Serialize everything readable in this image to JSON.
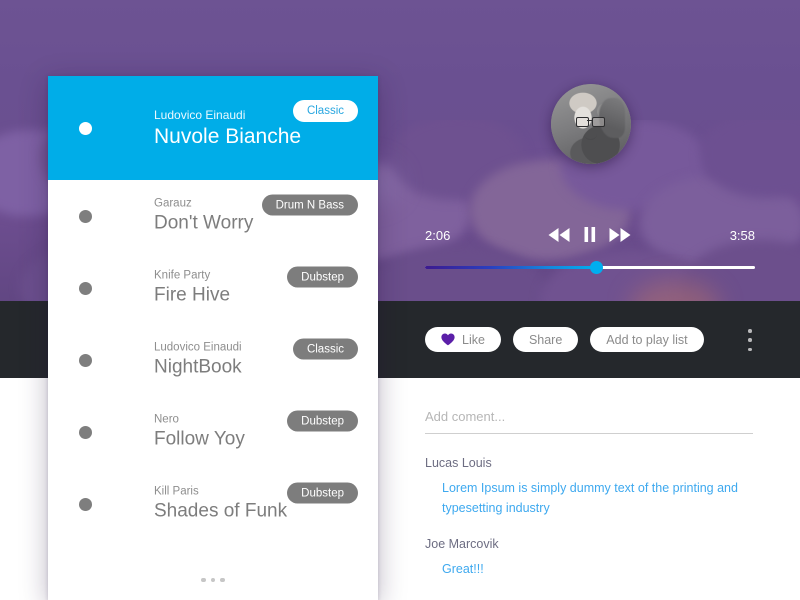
{
  "theme": {
    "accent_blue": "#00ade8",
    "bg_purple": "#6a5091",
    "dark_bar": "#25282c",
    "badge_gray": "#7d7d7d",
    "comment_link": "#3ea9ef",
    "heart_purple": "#5b1fa8"
  },
  "player": {
    "current_time": "2:06",
    "total_time": "3:58",
    "progress_percent": 52,
    "rewind_icon": "rewind-icon",
    "pause_icon": "pause-icon",
    "forward_icon": "forward-icon",
    "avatar_name": "avatar"
  },
  "actions": {
    "like_label": "Like",
    "like_icon": "heart-icon",
    "share_label": "Share",
    "add_to_playlist_label": "Add to play list",
    "overflow_icon": "kebab-menu-icon"
  },
  "comments_section": {
    "input_placeholder": "Add coment...",
    "input_value": "",
    "comments": [
      {
        "author": "Lucas Louis",
        "text": "Lorem Ipsum is simply dummy text of the printing and typesetting industry"
      },
      {
        "author": "Joe Marcovik",
        "text": "Great!!!"
      }
    ]
  },
  "playlist": {
    "more_icon": "more-dots-icon",
    "tracks": [
      {
        "artist": "Ludovico Einaudi",
        "title": "Nuvole Bianche",
        "genre": "Classic",
        "active": true
      },
      {
        "artist": "Garauz",
        "title": "Don't Worry",
        "genre": "Drum N Bass",
        "active": false
      },
      {
        "artist": "Knife Party",
        "title": "Fire Hive",
        "genre": "Dubstep",
        "active": false
      },
      {
        "artist": "Ludovico Einaudi",
        "title": "NightBook",
        "genre": "Classic",
        "active": false
      },
      {
        "artist": "Nero",
        "title": "Follow Yoy",
        "genre": "Dubstep",
        "active": false
      },
      {
        "artist": "Kill Paris",
        "title": "Shades of Funk",
        "genre": "Dubstep",
        "active": false
      }
    ]
  }
}
